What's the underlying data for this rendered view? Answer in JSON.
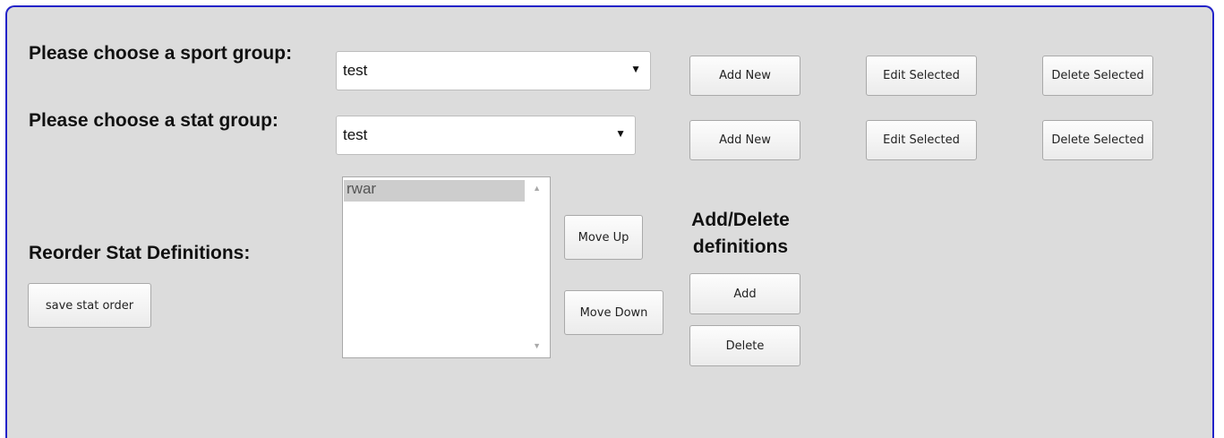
{
  "sport_group": {
    "label": "Please choose a sport group:",
    "selected": "test",
    "add_label": "Add New",
    "edit_label": "Edit Selected",
    "delete_label": "Delete Selected"
  },
  "stat_group": {
    "label": "Please choose a stat group:",
    "selected": "test",
    "add_label": "Add New",
    "edit_label": "Edit Selected",
    "delete_label": "Delete Selected"
  },
  "reorder": {
    "label": "Reorder Stat Definitions:",
    "save_label": "save stat order",
    "items": [
      "rwar"
    ],
    "move_up_label": "Move Up",
    "move_down_label": "Move Down"
  },
  "definitions": {
    "label": "Add/Delete definitions",
    "add_label": "Add",
    "delete_label": "Delete"
  },
  "icons": {
    "dropdown": "dropdown-arrow-icon",
    "scroll_up": "scroll-up-arrow-icon",
    "scroll_down": "scroll-down-arrow-icon"
  },
  "colors": {
    "panel_background": "#dcdcdc",
    "panel_border": "#2323c8",
    "selected_item": "#cdcdcd"
  }
}
